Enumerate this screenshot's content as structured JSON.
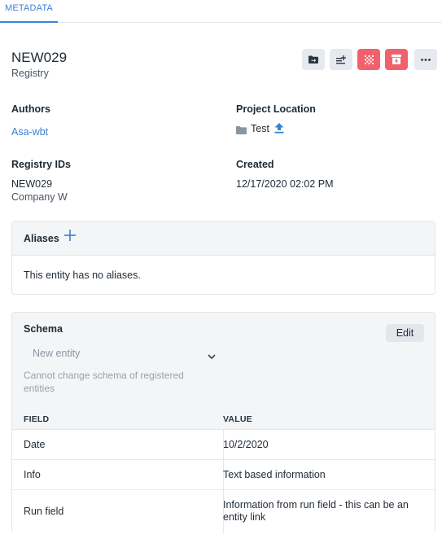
{
  "tabs": [
    {
      "label": "METADATA",
      "active": true
    }
  ],
  "entity": {
    "name": "NEW029",
    "type": "Registry"
  },
  "toolbar": {
    "buttons": [
      {
        "icon": "move-to-folder-icon",
        "style": "neutral"
      },
      {
        "icon": "sort-add-icon",
        "style": "neutral"
      },
      {
        "icon": "grid-dots-icon",
        "style": "danger"
      },
      {
        "icon": "archive-icon",
        "style": "danger"
      },
      {
        "icon": "more-options-icon",
        "style": "neutral"
      }
    ]
  },
  "fields": {
    "authors": {
      "label": "Authors",
      "value": "Asa-wbt"
    },
    "project_location": {
      "label": "Project Location",
      "value": "Test"
    },
    "registry_ids": {
      "label": "Registry IDs",
      "id": "NEW029",
      "company": "Company W"
    },
    "created": {
      "label": "Created",
      "value": "12/17/2020 02:02 PM"
    }
  },
  "aliases": {
    "title": "Aliases",
    "empty_text": "This entity has no aliases."
  },
  "schema": {
    "title": "Schema",
    "edit_label": "Edit",
    "select_value": "New entity",
    "note": "Cannot change schema of registered entities",
    "columns": [
      "FIELD",
      "VALUE"
    ],
    "rows": [
      {
        "field": "Date",
        "value": "10/2/2020"
      },
      {
        "field": "Info",
        "value": "Text based information"
      },
      {
        "field": "Run field",
        "value": "Information from run field - this can be an entity link"
      }
    ]
  },
  "colors": {
    "accent": "#3b82d6",
    "danger": "#f2606d",
    "panel_bg": "#f3f5f7"
  }
}
